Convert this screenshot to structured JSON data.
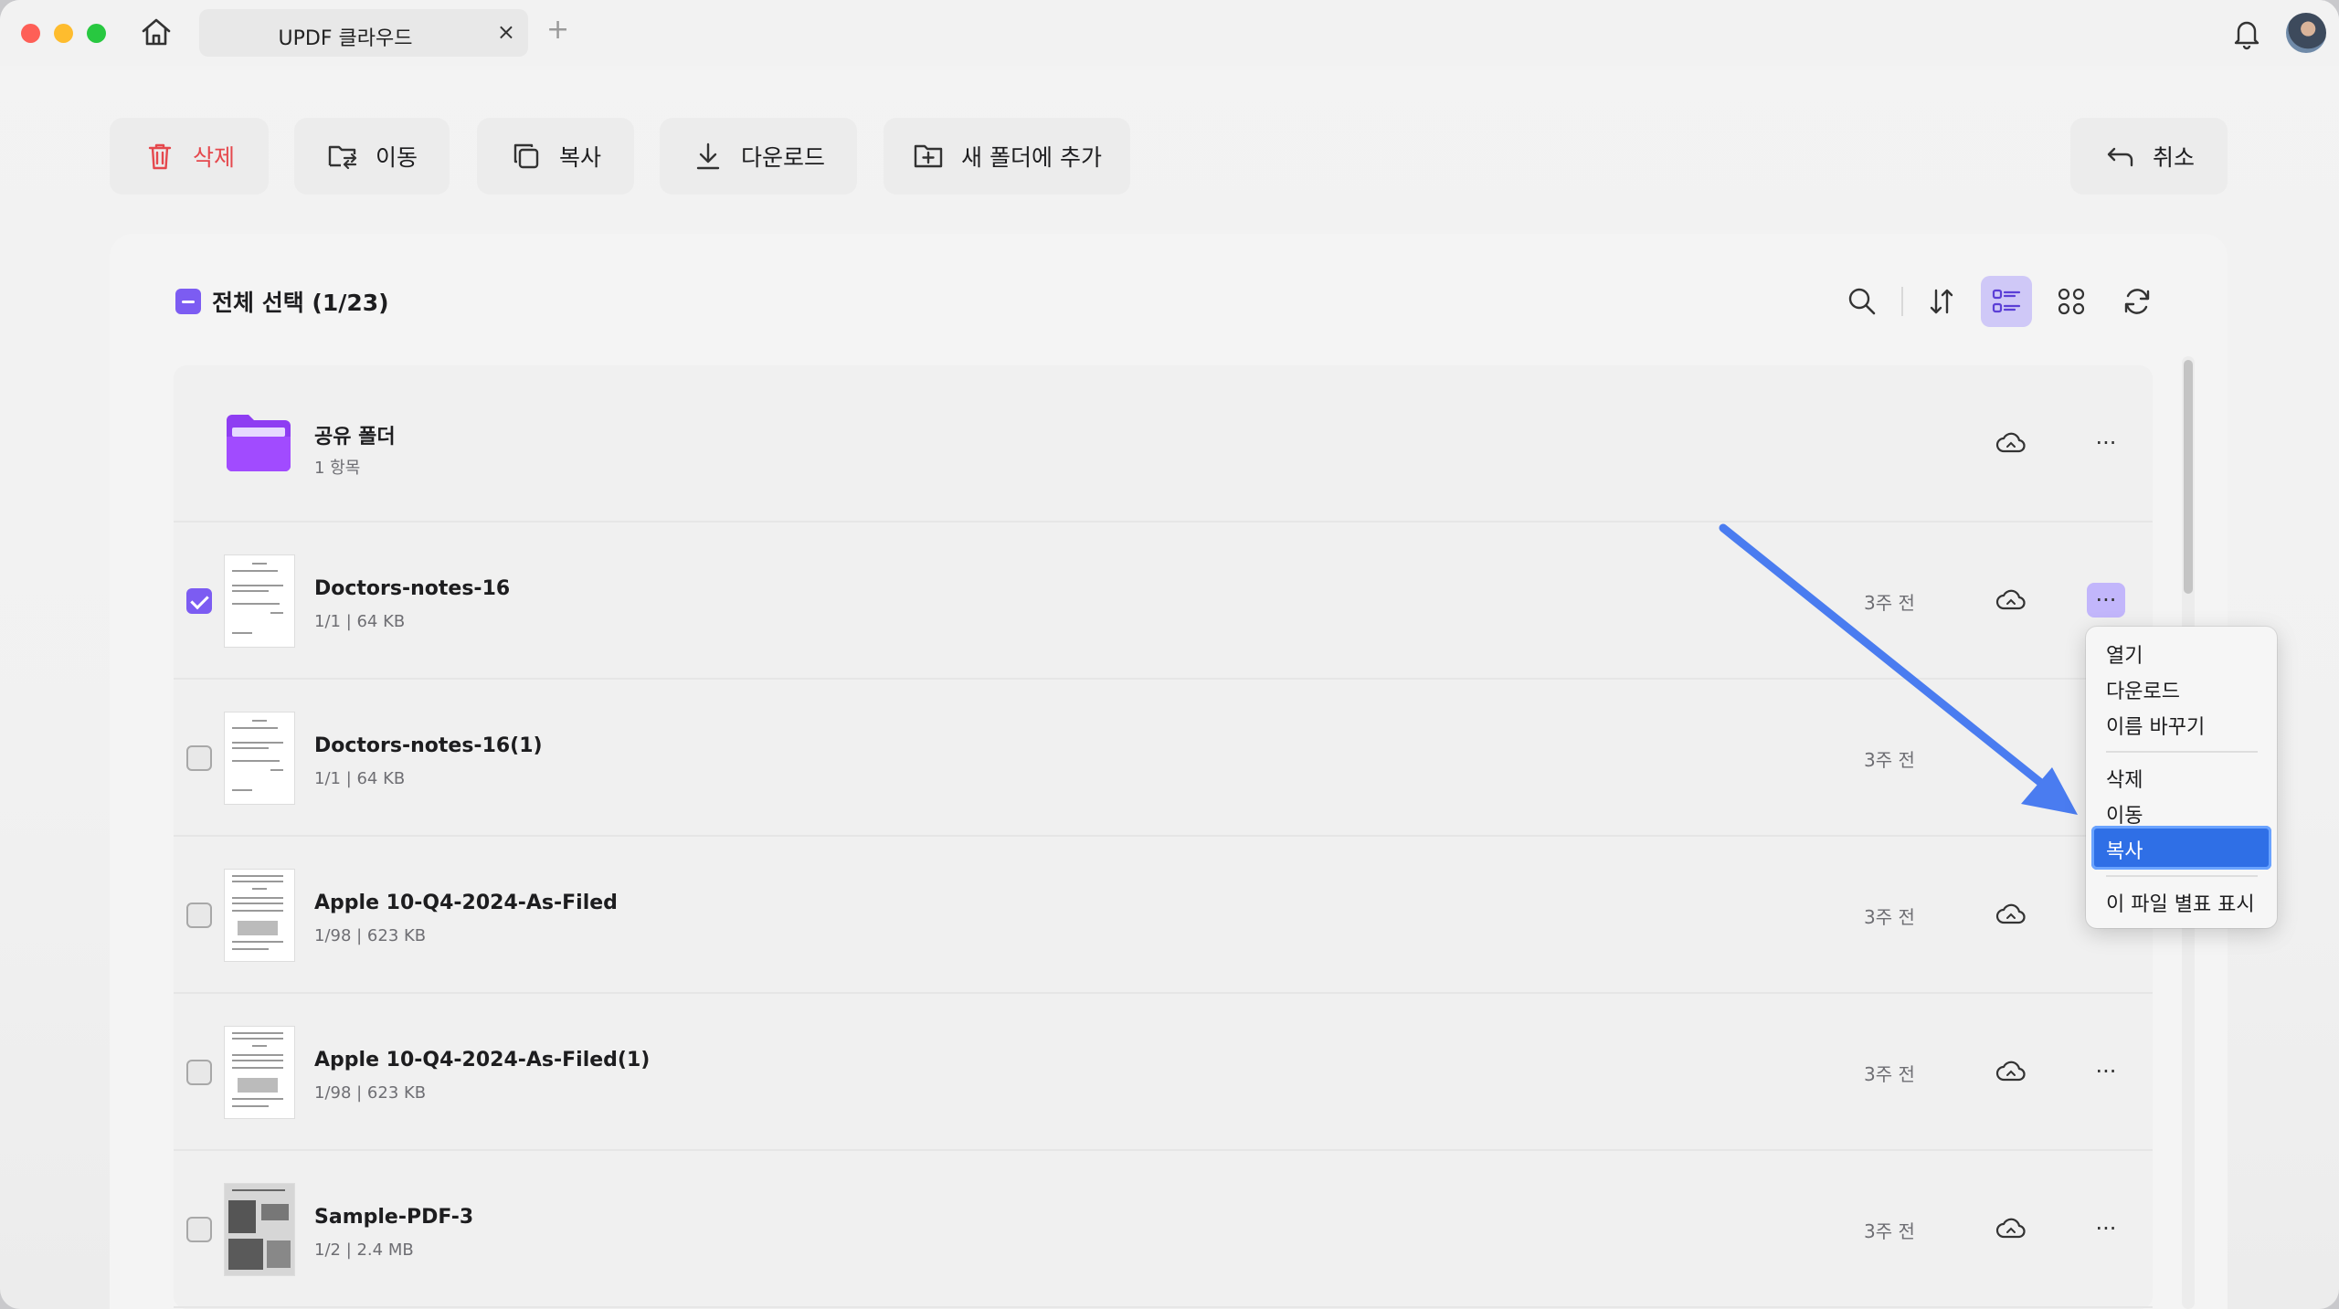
{
  "window": {
    "tab_title": "UPDF 클라우드",
    "tab_close": "×",
    "tab_add": "+"
  },
  "toolbar": {
    "delete_label": "삭제",
    "move_label": "이동",
    "copy_label": "복사",
    "download_label": "다운로드",
    "new_folder_label": "새 폴더에 추가",
    "cancel_label": "취소"
  },
  "selection": {
    "select_all_label": "전체 선택 (1/23)"
  },
  "files": [
    {
      "name": "공유 폴더",
      "meta": "1 항목",
      "date": "",
      "type": "folder",
      "checked": false
    },
    {
      "name": "Doctors-notes-16",
      "meta": "1/1 | 64 KB",
      "date": "3주 전",
      "type": "pdf",
      "checked": true
    },
    {
      "name": "Doctors-notes-16(1)",
      "meta": "1/1 | 64 KB",
      "date": "3주 전",
      "type": "pdf",
      "checked": false
    },
    {
      "name": "Apple 10-Q4-2024-As-Filed",
      "meta": "1/98 | 623 KB",
      "date": "3주 전",
      "type": "pdf",
      "checked": false
    },
    {
      "name": "Apple 10-Q4-2024-As-Filed(1)",
      "meta": "1/98 | 623 KB",
      "date": "3주 전",
      "type": "pdf",
      "checked": false
    },
    {
      "name": "Sample-PDF-3",
      "meta": "1/2 | 2.4 MB",
      "date": "3주 전",
      "type": "pdf-photo",
      "checked": false
    }
  ],
  "more_glyph": "···",
  "context_menu": {
    "items": [
      "열기",
      "다운로드",
      "이름 바꾸기",
      "삭제",
      "이동",
      "복사",
      "이 파일 별표 표시"
    ],
    "selected": "복사"
  },
  "colors": {
    "accent": "#7c5cf2",
    "danger": "#e5484d",
    "menu_highlight": "#2f6fe6",
    "annotation_arrow": "#4a7cf0"
  }
}
